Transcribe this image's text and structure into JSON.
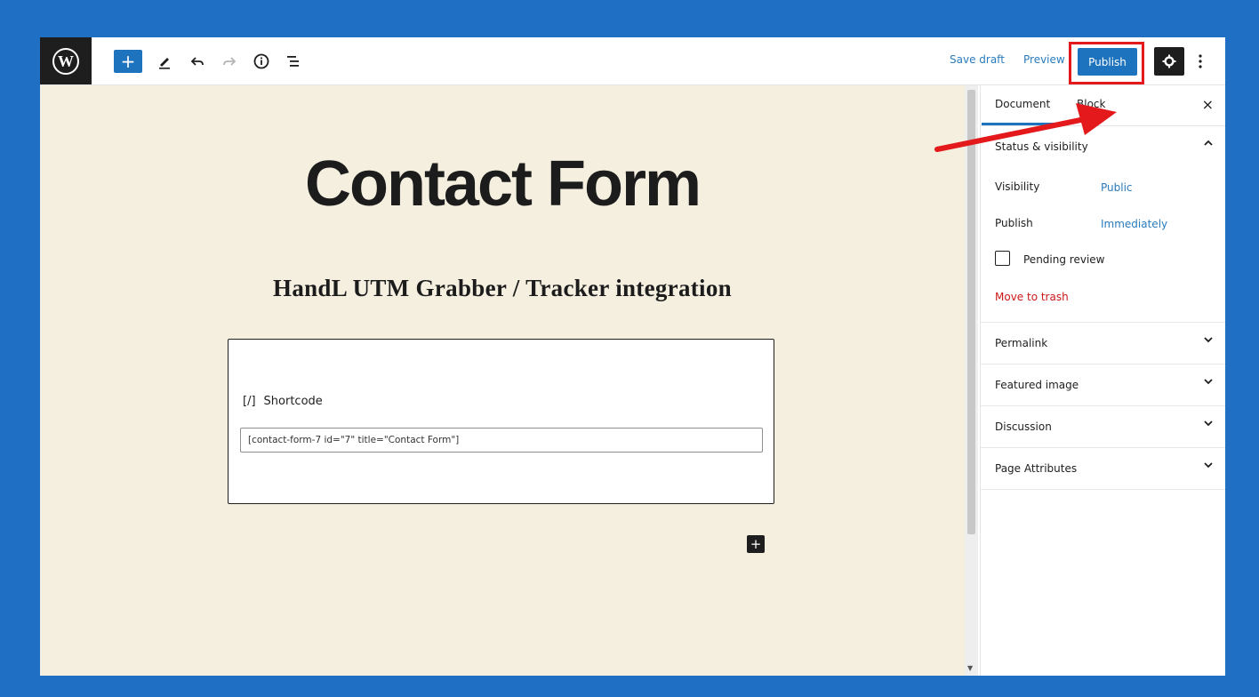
{
  "toolbar": {
    "logo_icon": "wordpress-logo",
    "add_icon": "+",
    "tools_icon": "pencil-icon",
    "undo_icon": "undo-icon",
    "redo_icon": "redo-icon",
    "info_icon": "info-icon",
    "outline_icon": "list-outline-icon",
    "save_draft": "Save draft",
    "preview": "Preview",
    "publish": "Publish",
    "settings_icon": "gear-icon",
    "more_icon": "vertical-ellipsis-icon"
  },
  "canvas": {
    "title": "Contact Form",
    "subtitle": "HandL UTM Grabber / Tracker integration",
    "shortcode_block": {
      "icon": "[/]",
      "label": "Shortcode",
      "value": "[contact-form-7 id=\"7\" title=\"Contact Form\"]"
    },
    "inline_add_icon": "+"
  },
  "sidebar": {
    "tabs": [
      {
        "label": "Document",
        "active": true
      },
      {
        "label": "Block",
        "active": false
      }
    ],
    "close_icon": "×",
    "status_panel": {
      "title": "Status & visibility",
      "expanded": true,
      "visibility_label": "Visibility",
      "visibility_value": "Public",
      "publish_label": "Publish",
      "publish_value": "Immediately",
      "pending_review_label": "Pending review",
      "pending_review_checked": false,
      "trash_label": "Move to trash"
    },
    "collapsed_panels": [
      {
        "title": "Permalink"
      },
      {
        "title": "Featured image"
      },
      {
        "title": "Discussion"
      },
      {
        "title": "Page Attributes"
      }
    ]
  },
  "colors": {
    "frame_background": "#1f6fc5",
    "primary": "#1e73be",
    "canvas_background": "#f5efe0",
    "annotation_red": "#e3191c",
    "trash_red": "#cc1818"
  }
}
